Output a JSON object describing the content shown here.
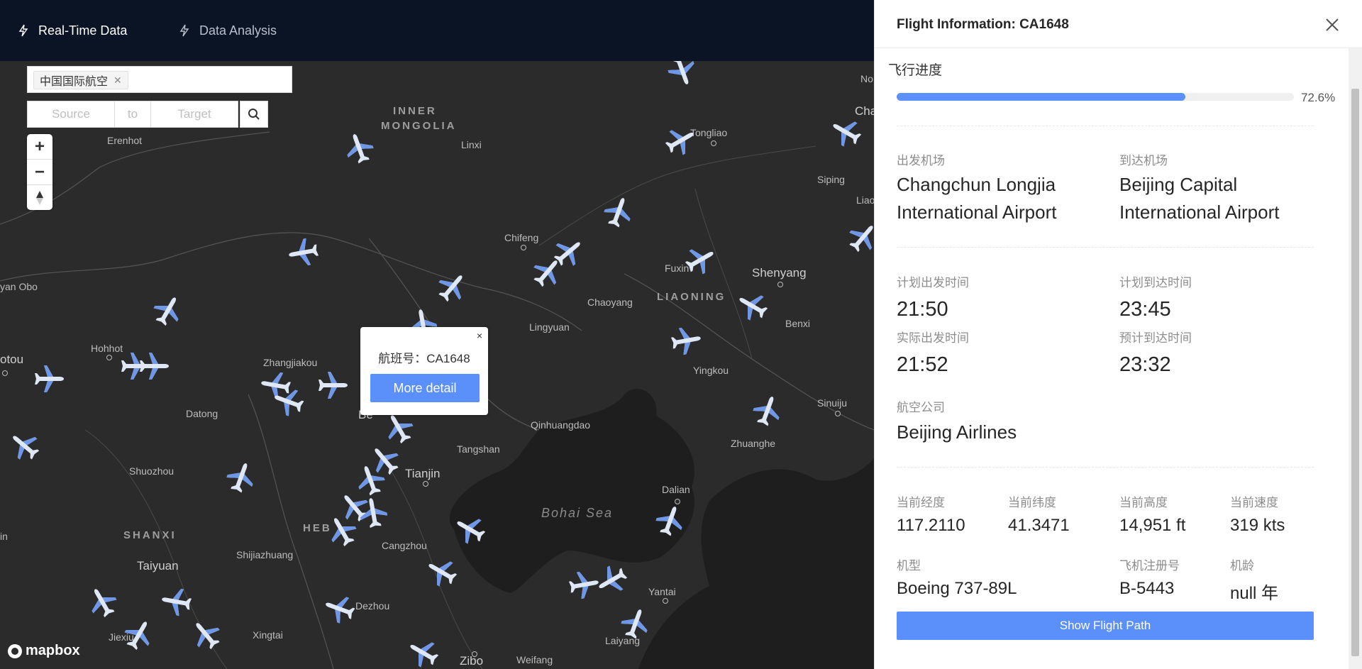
{
  "nav": {
    "items": [
      {
        "label": "Real-Time Data",
        "icon": "lightning-icon",
        "active": true
      },
      {
        "label": "Data Analysis",
        "icon": "lightning-icon",
        "active": false
      }
    ]
  },
  "search": {
    "tag": "中国国际航空",
    "source_placeholder": "Source",
    "to_label": "to",
    "target_placeholder": "Target"
  },
  "map": {
    "places": [
      "Erenhot",
      "Linxi",
      "Tongliao",
      "Siping",
      "Chifeng",
      "Fuxin",
      "Shenyang",
      "Chaoyang",
      "Lingyuan",
      "Benxi",
      "Hohhot",
      "Zhangjiakou",
      "Yingkou",
      "Datong",
      "Qinhuangdao",
      "Sinuiju",
      "Zhuanghe",
      "Tangshan",
      "Tianjin",
      "Shuozhou",
      "Dalian",
      "Cangzhou",
      "Shijiazhuang",
      "Taiyuan",
      "Yantai",
      "Dezhou",
      "Xingtai",
      "Jiexiu",
      "Laiyang",
      "Zibo",
      "Weifang",
      "yan Obo",
      "otou",
      "Liao",
      "Cha",
      "No",
      "in",
      "Be"
    ],
    "regions": [
      "INNER",
      "MONGOLIA",
      "LIAONING",
      "SHANXI",
      "HEB"
    ],
    "sea": "Bohai Sea",
    "attribution": "mapbox"
  },
  "popup": {
    "flight_label": "航班号：CA1648",
    "button": "More detail",
    "close": "×"
  },
  "panel": {
    "title": "Flight Information: CA1648",
    "progress_label": "飞行进度",
    "progress": 72.6,
    "progress_text": "72.6%",
    "departure_label": "出发机场",
    "departure_line1": "Changchun Longjia",
    "departure_line2": "International Airport",
    "arrival_label": "到达机场",
    "arrival_line1": "Beijing Capital",
    "arrival_line2": "International Airport",
    "sched_dep_label": "计划出发时间",
    "sched_dep": "21:50",
    "sched_arr_label": "计划到达时间",
    "sched_arr": "23:45",
    "actual_dep_label": "实际出发时间",
    "actual_dep": "21:52",
    "est_arr_label": "预计到达时间",
    "est_arr": "23:32",
    "airline_label": "航空公司",
    "airline": "Beijing Airlines",
    "lon_label": "当前经度",
    "lon": "117.2110",
    "lat_label": "当前纬度",
    "lat": "41.3471",
    "alt_label": "当前高度",
    "alt": "14,951 ft",
    "speed_label": "当前速度",
    "speed": "319 kts",
    "model_label": "机型",
    "model": "Boeing 737-89L",
    "reg_label": "飞机注册号",
    "reg": "B-5443",
    "age_label": "机龄",
    "age": "null 年",
    "path_button": "Show Flight Path"
  },
  "colors": {
    "accent": "#5b8ff9",
    "nav_bg": "#0b1424",
    "map_bg": "#2b2b2b"
  }
}
